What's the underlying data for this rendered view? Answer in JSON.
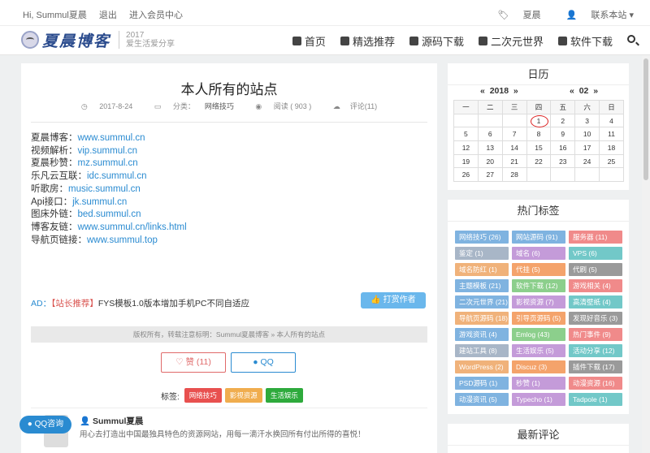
{
  "topbar": {
    "greeting": "Hi, Summul夏晨",
    "logout": "退出",
    "member": "进入会员中心",
    "user": "夏晨",
    "contact": "联系本站"
  },
  "header": {
    "logo_text": "夏晨博客",
    "logo_year": "2017",
    "logo_slogan": "爱生活爱分享",
    "nav": [
      "首页",
      "精选推荐",
      "源码下载",
      "二次元世界",
      "软件下载"
    ]
  },
  "post": {
    "title": "本人所有的站点",
    "date": "2017-8-24",
    "category_label": "分类：",
    "category": "网络技巧",
    "views": "阅读 ( 903 )",
    "comments": "评论(11)",
    "sites": [
      {
        "label": "夏晨博客：",
        "url": "www.summul.cn"
      },
      {
        "label": "视频解析：",
        "url": "vip.summul.cn"
      },
      {
        "label": "夏晨秒赞：",
        "url": "mz.summul.cn"
      },
      {
        "label": "乐凡云互联：",
        "url": "idc.summul.cn"
      },
      {
        "label": "听歌房：",
        "url": "music.summul.cn"
      },
      {
        "label": "Api接口：",
        "url": "jk.summul.cn"
      },
      {
        "label": "图床外链：",
        "url": "bed.summul.cn"
      },
      {
        "label": "博客友链：",
        "url": "www.summul.cn/links.html"
      },
      {
        "label": "导航页链接：",
        "url": "www.summul.top"
      }
    ],
    "ad_label": "AD：",
    "ad_tag": "【站长推荐】",
    "ad_text": "FYS模板1.0版本增加手机PC不同自适应",
    "reward": "打赏作者",
    "copyright": "版权所有，转载注意标明：Summul夏晨博客 » 本人所有的站点",
    "like": "赞 (11)",
    "qq": "QQ",
    "tags_label": "标签:",
    "tags": [
      {
        "name": "网络技巧",
        "color": "#e8504f"
      },
      {
        "name": "影视资源",
        "color": "#f0ad4e"
      },
      {
        "name": "生活娱乐",
        "color": "#2eaa3c"
      }
    ],
    "author_name": "Summul夏晨",
    "author_desc": "用心去打造出中国最独具特色的资源网站，用每一滴汗水换回所有付出所得的喜悦！"
  },
  "float_qq": "QQ咨询",
  "calendar": {
    "title": "日历",
    "year": "2018",
    "month": "02",
    "weekdays": [
      "一",
      "二",
      "三",
      "四",
      "五",
      "六",
      "日"
    ],
    "rows": [
      [
        "",
        "",
        "",
        "1",
        "2",
        "3",
        "4"
      ],
      [
        "5",
        "6",
        "7",
        "8",
        "9",
        "10",
        "11"
      ],
      [
        "12",
        "13",
        "14",
        "15",
        "16",
        "17",
        "18"
      ],
      [
        "19",
        "20",
        "21",
        "22",
        "23",
        "24",
        "25"
      ],
      [
        "26",
        "27",
        "28",
        "",
        "",
        "",
        ""
      ]
    ],
    "today": "1"
  },
  "hot_tags": {
    "title": "热门标签",
    "items": [
      {
        "name": "网络技巧 (26)",
        "color": "#7fb3e0"
      },
      {
        "name": "网站源码 (91)",
        "color": "#7fb3e0"
      },
      {
        "name": "服务器 (11)",
        "color": "#f08a8a"
      },
      {
        "name": "鉴定 (1)",
        "color": "#a8b6c7"
      },
      {
        "name": "域名 (6)",
        "color": "#c49bd9"
      },
      {
        "name": "VPS (6)",
        "color": "#72c8c8"
      },
      {
        "name": "域名防红 (1)",
        "color": "#f0b27a"
      },
      {
        "name": "代挂 (5)",
        "color": "#f4a36b"
      },
      {
        "name": "代刷 (5)",
        "color": "#9a9a9a"
      },
      {
        "name": "主题模板 (21)",
        "color": "#7fb3e0"
      },
      {
        "name": "软件下载 (12)",
        "color": "#8ccf8c"
      },
      {
        "name": "游戏相关 (4)",
        "color": "#f08a8a"
      },
      {
        "name": "二次元世界 (21)",
        "color": "#7fb3e0"
      },
      {
        "name": "影视资源 (7)",
        "color": "#c49bd9"
      },
      {
        "name": "高清壁纸 (4)",
        "color": "#72c8c8"
      },
      {
        "name": "导航页源码 (18)",
        "color": "#f0b27a"
      },
      {
        "name": "引导页源码 (5)",
        "color": "#f4a36b"
      },
      {
        "name": "发现好音乐 (3)",
        "color": "#9a9a9a"
      },
      {
        "name": "游戏资讯 (4)",
        "color": "#7fb3e0"
      },
      {
        "name": "Emlog (43)",
        "color": "#8ccf8c"
      },
      {
        "name": "热门事件 (9)",
        "color": "#f08a8a"
      },
      {
        "name": "建站工具 (8)",
        "color": "#a8b6c7"
      },
      {
        "name": "生活娱乐 (5)",
        "color": "#c49bd9"
      },
      {
        "name": "活动分享 (12)",
        "color": "#72c8c8"
      },
      {
        "name": "WordPress (2)",
        "color": "#f0b27a"
      },
      {
        "name": "Discuz (3)",
        "color": "#f4a36b"
      },
      {
        "name": "插件下载 (17)",
        "color": "#9a9a9a"
      },
      {
        "name": "PSD源码 (1)",
        "color": "#7fb3e0"
      },
      {
        "name": "秒赞 (1)",
        "color": "#c49bd9"
      },
      {
        "name": "动漫资源 (16)",
        "color": "#f08a8a"
      },
      {
        "name": "动漫资讯 (5)",
        "color": "#7fb3e0"
      },
      {
        "name": "Typecho (1)",
        "color": "#c49bd9"
      },
      {
        "name": "Tadpole (1)",
        "color": "#72c8c8"
      }
    ]
  },
  "latest_comments": {
    "title": "最新评论"
  }
}
